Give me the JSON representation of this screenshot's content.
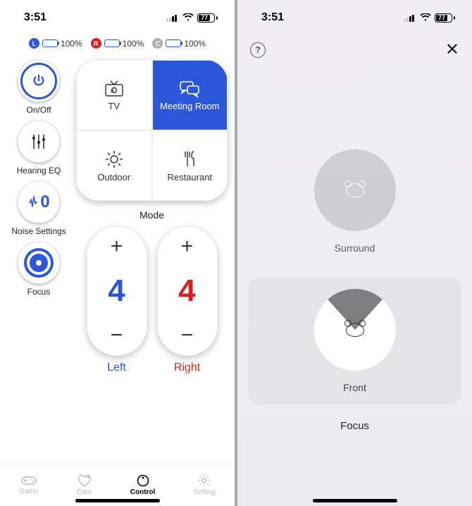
{
  "status": {
    "time": "3:51",
    "battery_pct": "77"
  },
  "devices": [
    {
      "badge": "L",
      "pct": "100%",
      "color": "#2b58d9"
    },
    {
      "badge": "R",
      "pct": "100%",
      "color": "#d92020"
    },
    {
      "badge": "C",
      "pct": "100%",
      "color": "#b0b0b0"
    }
  ],
  "side_buttons": {
    "power": "On/Off",
    "eq": "Hearing EQ",
    "noise": "Noise Settings",
    "noise_value": "0",
    "focus": "Focus"
  },
  "modes": {
    "label": "Mode",
    "items": [
      "TV",
      "Meeting Room",
      "Outdoor",
      "Restaurant"
    ],
    "active_index": 1
  },
  "volume": {
    "left": {
      "value": "4",
      "label": "Left"
    },
    "right": {
      "value": "4",
      "label": "Right"
    }
  },
  "tabs": [
    "Game",
    "Care",
    "Control",
    "Setting"
  ],
  "tabs_active_index": 2,
  "focus_sheet": {
    "surround": "Surround",
    "front": "Front",
    "title": "Focus"
  }
}
